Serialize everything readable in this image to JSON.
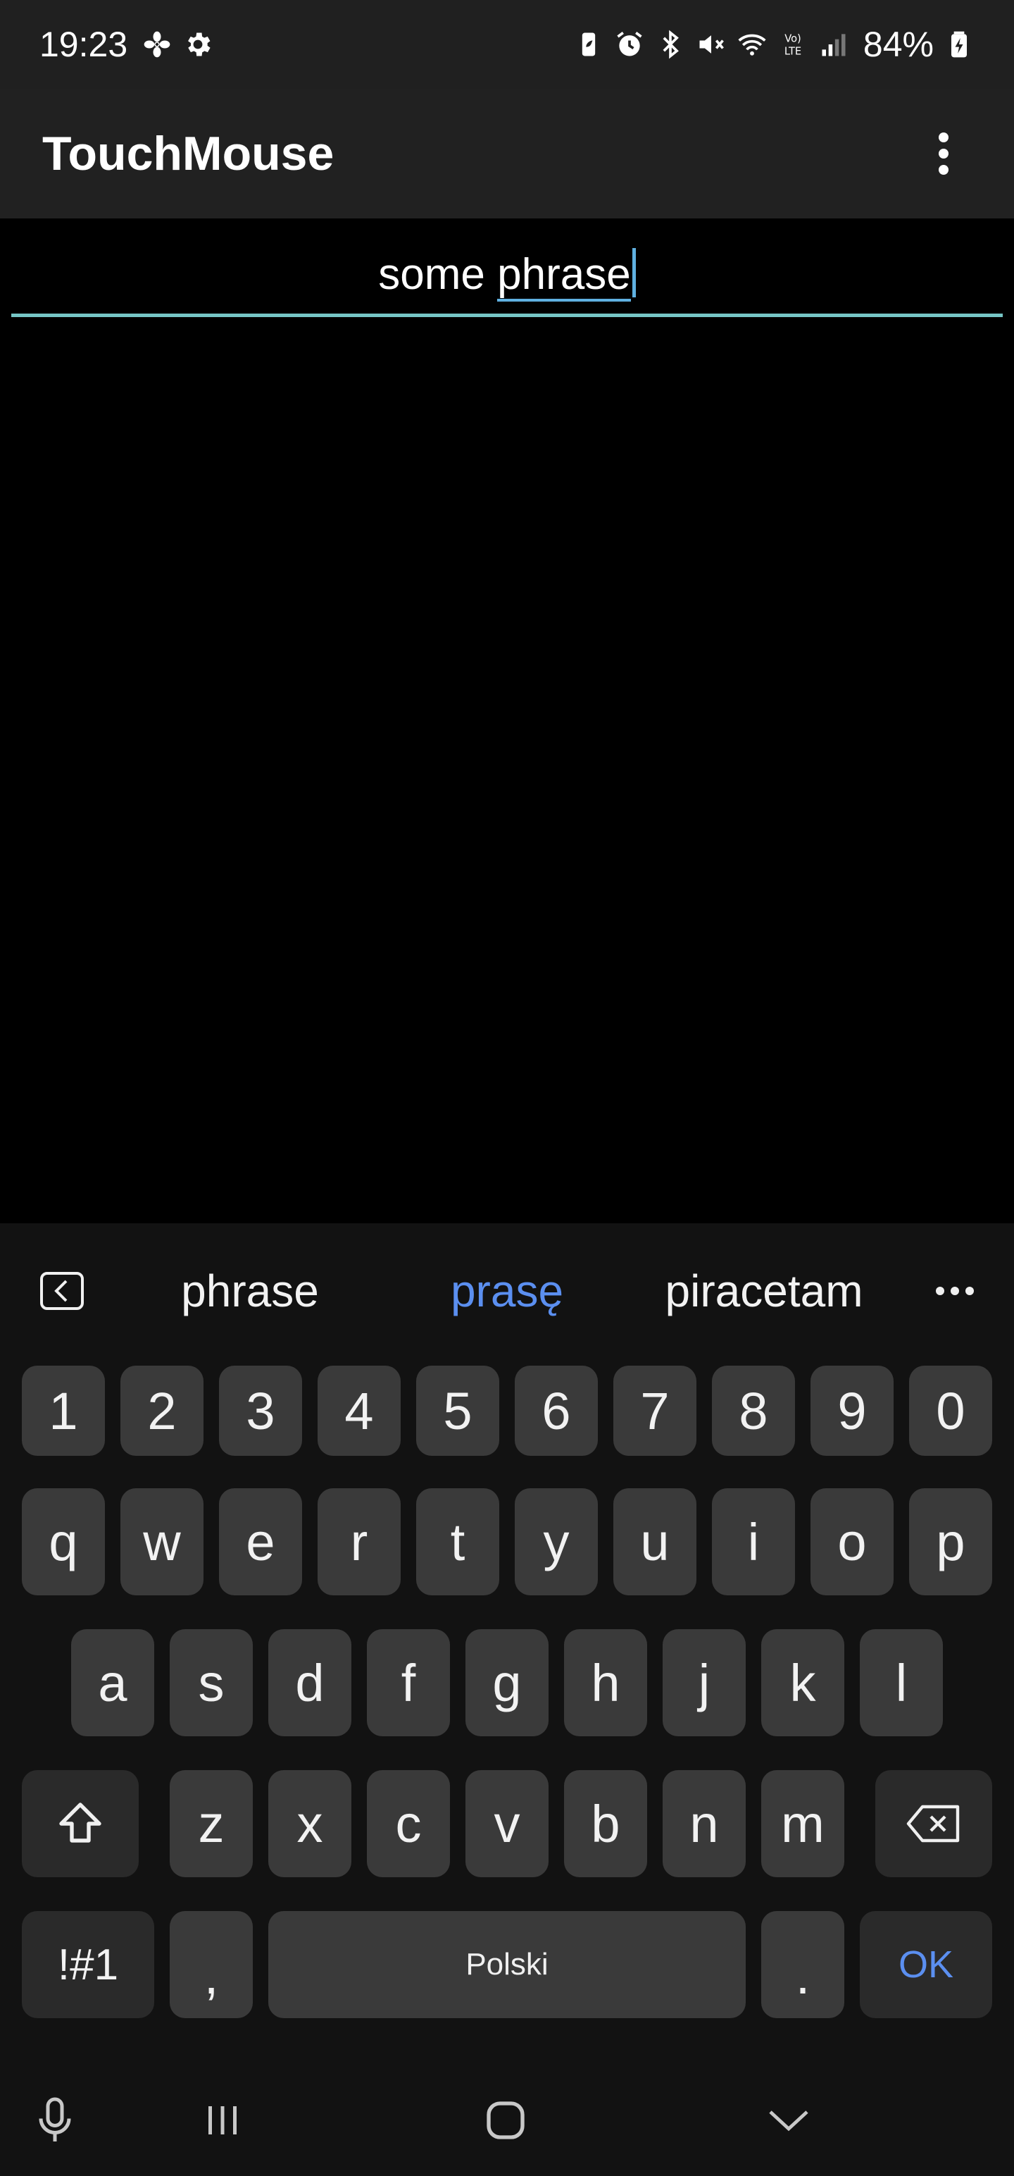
{
  "status_bar": {
    "time": "19:23",
    "battery_text": "84%",
    "left_icons": [
      "fan-icon",
      "settings-gear-icon"
    ],
    "right_icons": [
      "battery-saver-icon",
      "alarm-icon",
      "bluetooth-icon",
      "mute-icon",
      "wifi-icon",
      "volte-icon",
      "signal-icon",
      "battery-charging-icon"
    ]
  },
  "app_bar": {
    "title": "TouchMouse",
    "menu_icon": "more-vert-icon"
  },
  "input": {
    "text_prefix": "some ",
    "text_word": "phrase"
  },
  "keyboard": {
    "suggestions": [
      "phrase",
      "prasę",
      "piracetam"
    ],
    "row_numbers": [
      "1",
      "2",
      "3",
      "4",
      "5",
      "6",
      "7",
      "8",
      "9",
      "0"
    ],
    "row_1": [
      "q",
      "w",
      "e",
      "r",
      "t",
      "y",
      "u",
      "i",
      "o",
      "p"
    ],
    "row_2": [
      "a",
      "s",
      "d",
      "f",
      "g",
      "h",
      "j",
      "k",
      "l"
    ],
    "row_3": [
      "z",
      "x",
      "c",
      "v",
      "b",
      "n",
      "m"
    ],
    "symbols_label": "!#1",
    "comma": ",",
    "space_label": "Polski",
    "period": ".",
    "ok_label": "OK",
    "accent_color": "#5b8ff0"
  },
  "nav_bar": {
    "icons": [
      "microphone-icon",
      "recent-apps-icon",
      "home-icon",
      "hide-keyboard-icon"
    ]
  }
}
